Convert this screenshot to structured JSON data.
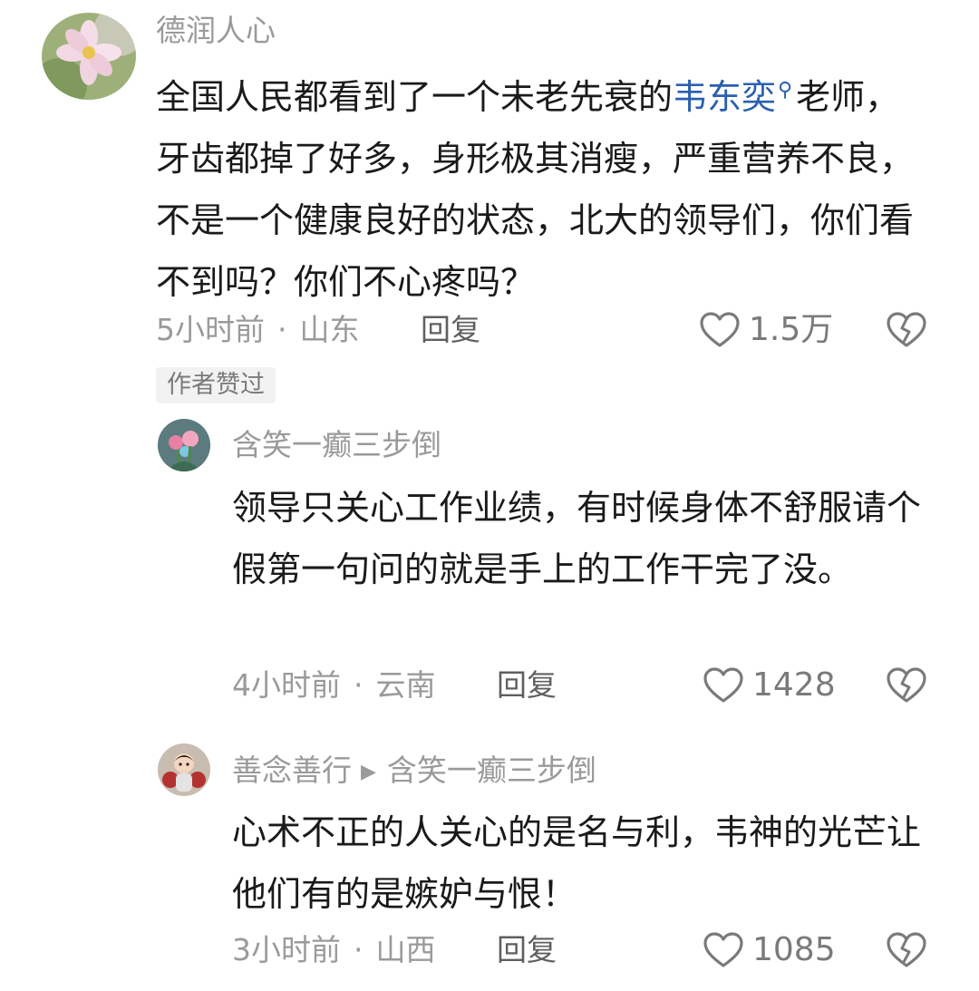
{
  "comments": [
    {
      "author": "德润人心",
      "text_before": "全国人民都看到了一个未老先衰的",
      "link": "韦东奕",
      "text_after": "老师，牙齿都掉了好多，身形极其消瘦，严重营养不良，不是一个健康良好的状态，北大的领导们，你们看不到吗？你们不心疼吗？",
      "time": "5小时前",
      "location": "山东",
      "reply_label": "回复",
      "likes": "1.5万",
      "badge": "作者赞过"
    },
    {
      "author": "含笑一癫三步倒",
      "text": "领导只关心工作业绩，有时候身体不舒服请个假第一句问的就是手上的工作干完了没。",
      "time": "4小时前",
      "location": "云南",
      "reply_label": "回复",
      "likes": "1428"
    },
    {
      "author": "善念善行",
      "reply_to": "含笑一癫三步倒",
      "text": "心术不正的人关心的是名与利，韦神的光芒让他们有的是嫉妒与恨！",
      "time": "3小时前",
      "location": "山西",
      "reply_label": "回复",
      "likes": "1085"
    }
  ],
  "icons": {
    "like": "heart-outline-icon",
    "dislike": "broken-heart-icon",
    "search": "search-icon",
    "reply_arrow": "play-arrow-icon"
  },
  "colors": {
    "link": "#2b5fb0",
    "meta": "#9a9a9a",
    "text": "#1a1a1a"
  }
}
